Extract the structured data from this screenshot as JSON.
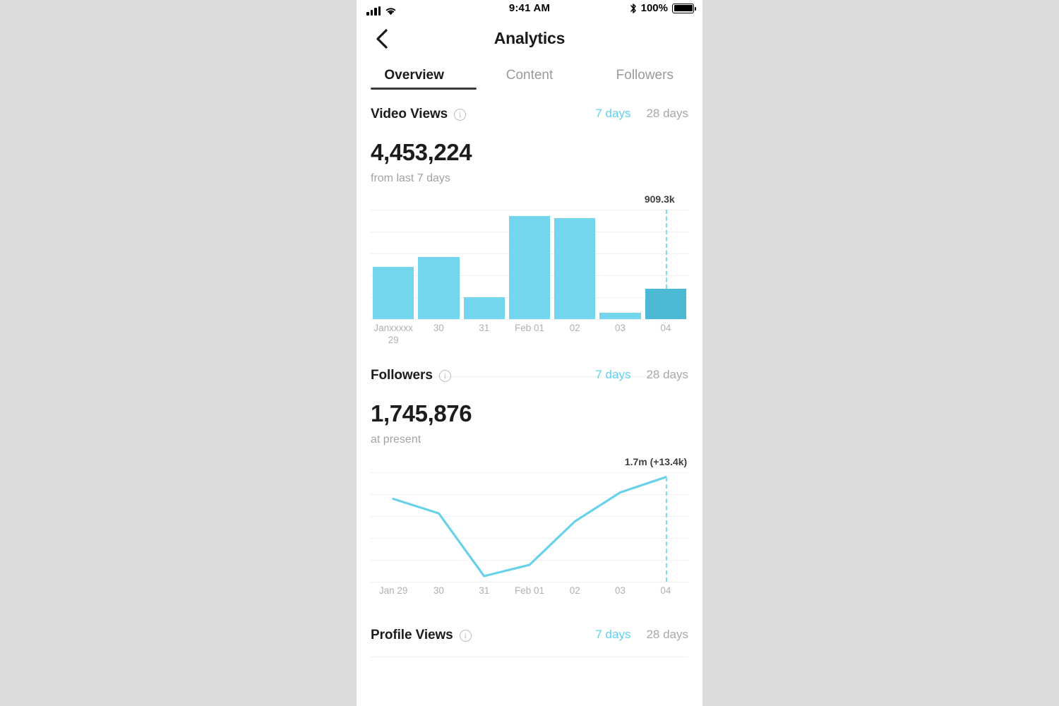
{
  "status_bar": {
    "time": "9:41 AM",
    "battery_percent": "100%",
    "signal_icon": "cellular-signal-icon",
    "wifi_icon": "wifi-icon",
    "bluetooth_icon": "bluetooth-icon",
    "battery_icon": "battery-full-icon"
  },
  "nav": {
    "back_icon": "chevron-left-icon",
    "title": "Analytics"
  },
  "tabs": [
    {
      "label": "Overview",
      "active": true
    },
    {
      "label": "Content",
      "active": false
    },
    {
      "label": "Followers",
      "active": false
    }
  ],
  "colors": {
    "accent": "#5fd2ec",
    "bar": "#74d6ec",
    "bar_selected": "#4cb9d5",
    "line": "#69d2ea",
    "text_primary": "#1c1c1c",
    "text_muted": "#a8a8a8",
    "grid": "#f0f0f0"
  },
  "sections": {
    "video_views": {
      "title": "Video Views",
      "info_icon": "info-circle-icon",
      "range_options": [
        "7 days",
        "28 days"
      ],
      "range_selected": "7 days",
      "value": "4,453,224",
      "subtitle": "from last 7 days"
    },
    "followers": {
      "title": "Followers",
      "info_icon": "info-circle-icon",
      "range_options": [
        "7 days",
        "28 days"
      ],
      "range_selected": "7 days",
      "value": "1,745,876",
      "subtitle": "at present"
    },
    "profile_views": {
      "title": "Profile Views",
      "info_icon": "info-circle-icon",
      "range_options": [
        "7 days",
        "28 days"
      ],
      "range_selected": "7 days"
    }
  },
  "chart_data": [
    {
      "type": "bar",
      "title": "Video Views",
      "xlabel": "",
      "ylabel": "",
      "grid": true,
      "legend": "none",
      "categories": [
        "Janxxxxx 29",
        "30",
        "31",
        "Feb 01",
        "02",
        "03",
        "04"
      ],
      "tick_labels": [
        "Janxxxxx\n29",
        "30",
        "31",
        "Feb 01",
        "02",
        "03",
        "04"
      ],
      "values": [
        480,
        570,
        200,
        940,
        925,
        55,
        280
      ],
      "value_unit": "k views",
      "ylim": [
        0,
        1000
      ],
      "highlight_index": 6,
      "annotation": {
        "text": "909.3k",
        "at_category": "04",
        "marker": "dashed-vertical-line"
      }
    },
    {
      "type": "line",
      "title": "Followers",
      "xlabel": "",
      "ylabel": "",
      "grid": true,
      "legend": "none",
      "categories": [
        "Jan 29",
        "30",
        "31",
        "Feb 01",
        "02",
        "03",
        "04"
      ],
      "tick_labels": [
        "Jan 29",
        "30",
        "31",
        "Feb 01",
        "02",
        "03",
        "04"
      ],
      "values": [
        1.6865,
        1.6775,
        1.6385,
        1.6455,
        1.6725,
        1.6905,
        1.7
      ],
      "value_unit": "m followers",
      "ylim": [
        1.635,
        1.703
      ],
      "annotation": {
        "text": "1.7m (+13.4k)",
        "at_category": "04",
        "marker": "dashed-vertical-line"
      }
    }
  ]
}
